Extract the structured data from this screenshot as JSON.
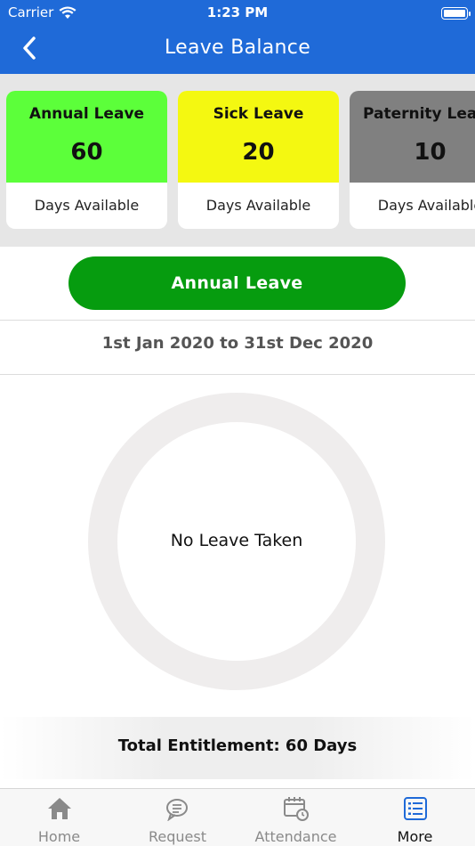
{
  "status_bar": {
    "carrier": "Carrier",
    "time": "1:23 PM"
  },
  "nav": {
    "title": "Leave Balance"
  },
  "leave_types": [
    {
      "title": "Annual Leave",
      "count": "60",
      "caption": "Days Available",
      "color": "#5cff3a"
    },
    {
      "title": "Sick Leave",
      "count": "20",
      "caption": "Days Available",
      "color": "#f4f811"
    },
    {
      "title": "Paternity Leave",
      "count": "10",
      "caption": "Days Available",
      "color": "#808080"
    }
  ],
  "selected": {
    "button_label": "Annual Leave",
    "button_color": "#069c0f",
    "period": "1st Jan 2020 to 31st Dec 2020",
    "chart_center": "No Leave Taken",
    "total": "Total Entitlement: 60 Days"
  },
  "tabs": [
    {
      "label": "Home",
      "icon": "home-icon",
      "active": false
    },
    {
      "label": "Request",
      "icon": "chat-bubbles-icon",
      "active": false
    },
    {
      "label": "Attendance",
      "icon": "calendar-clock-icon",
      "active": false
    },
    {
      "label": "More",
      "icon": "list-icon",
      "active": true
    }
  ],
  "colors": {
    "nav": "#1f6ad8",
    "active_tab": "#1f6ad8",
    "inactive_tab": "#8a8a8a"
  }
}
